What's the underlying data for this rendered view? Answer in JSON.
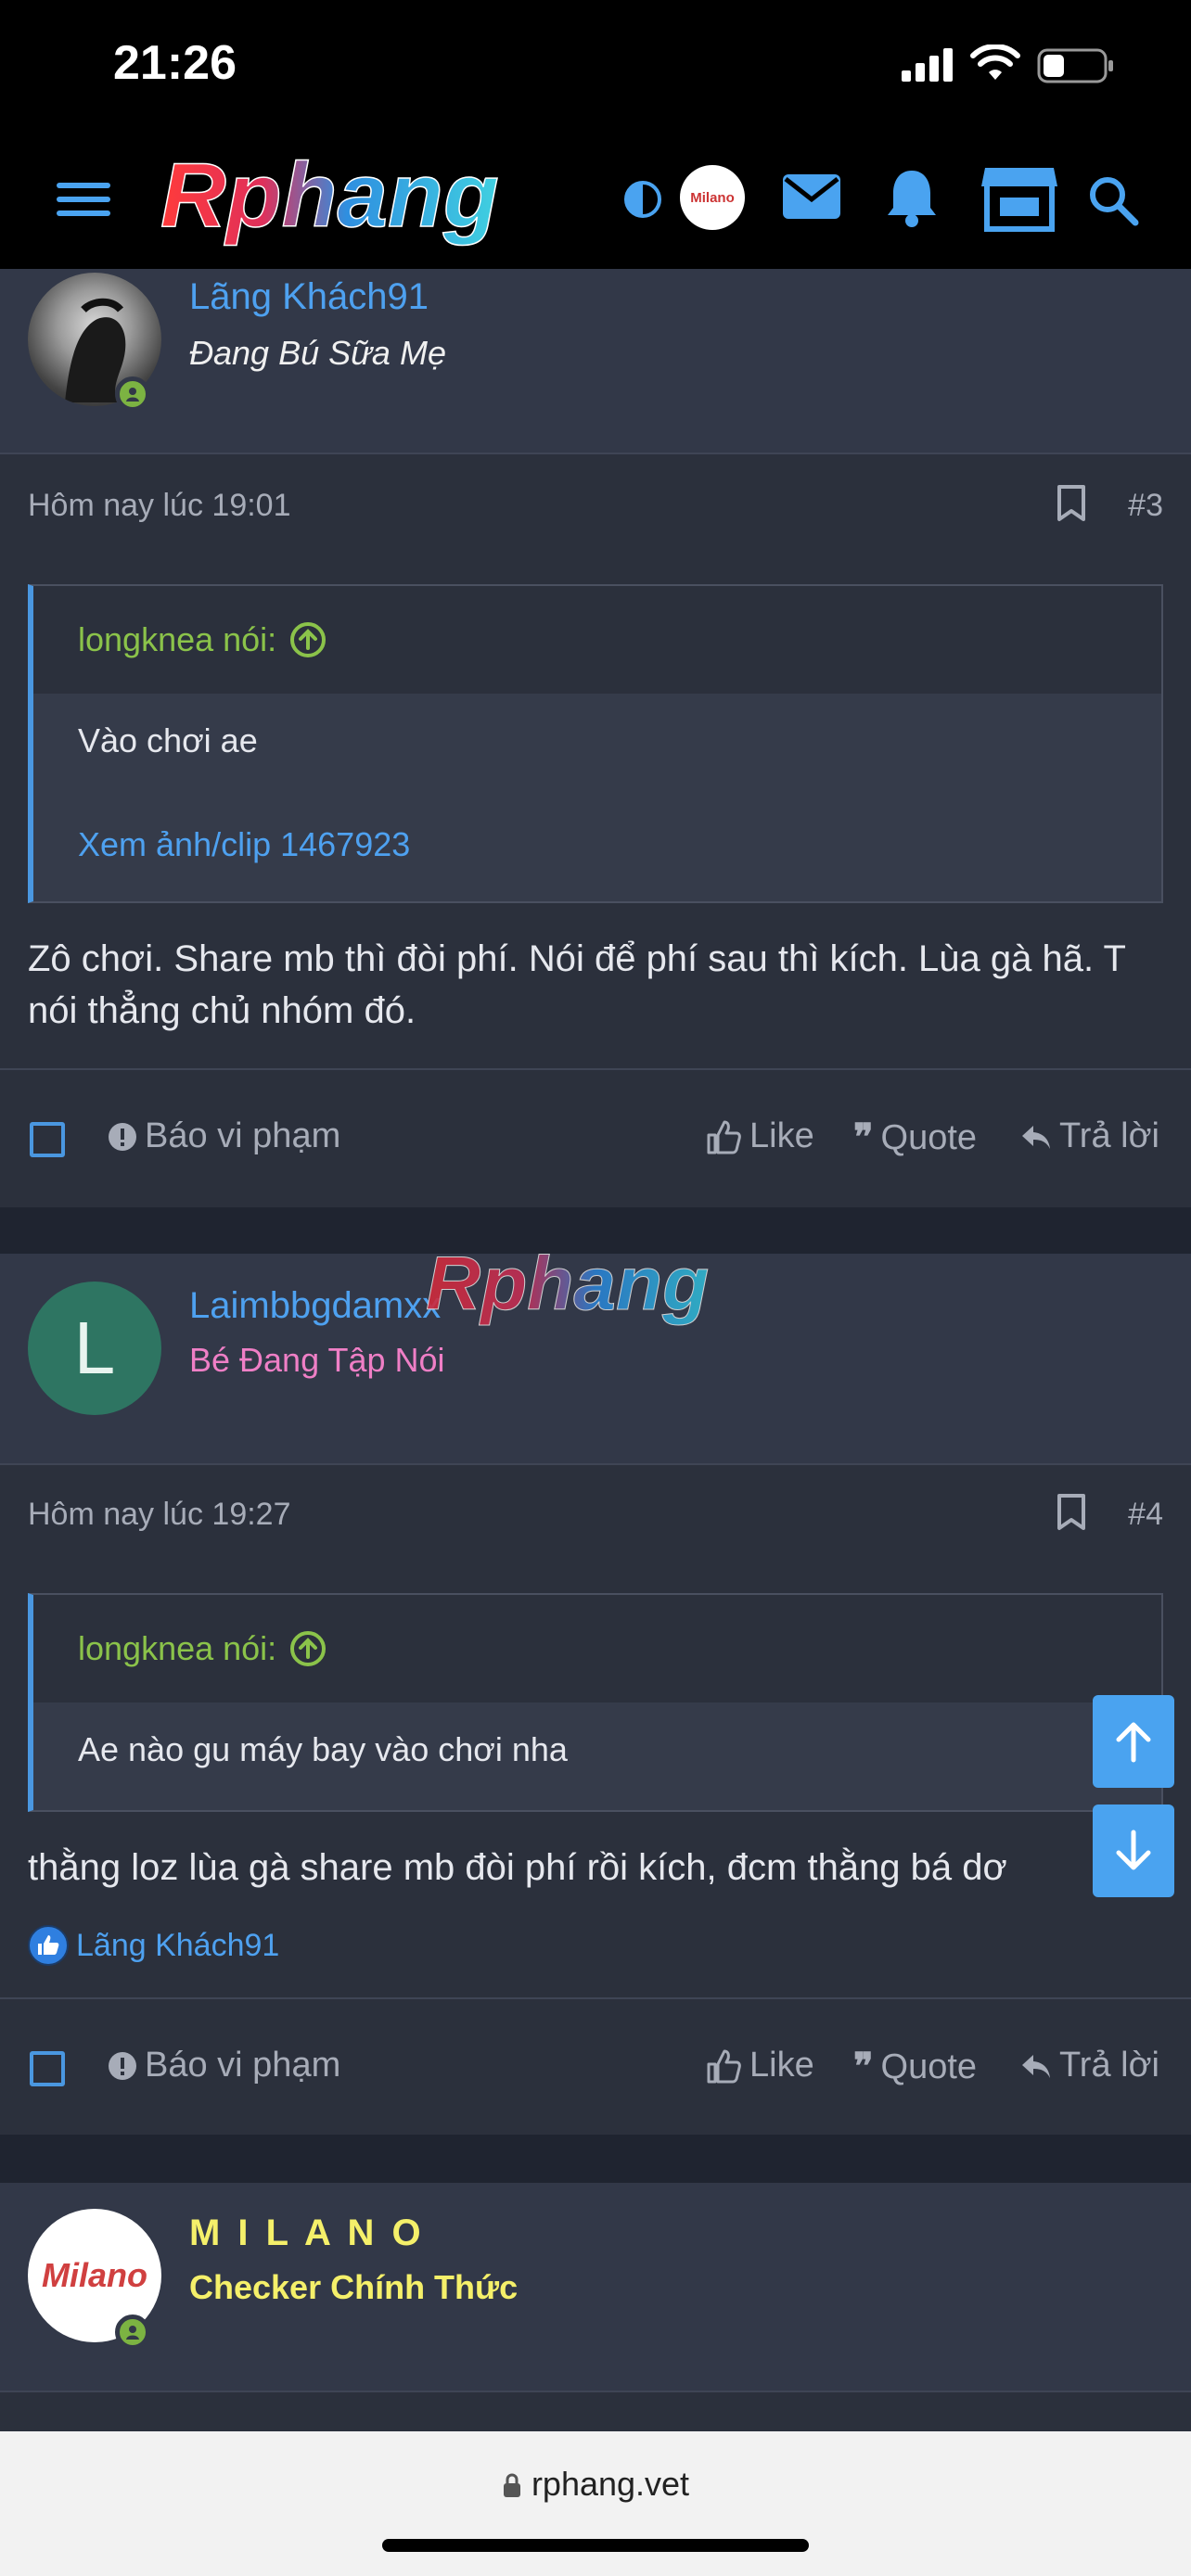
{
  "status": {
    "time": "21:26"
  },
  "header": {
    "logo": "Rphang",
    "avatar_text": "Milano"
  },
  "posts": [
    {
      "username": "Lãng Khách91",
      "usertitle": "Đang Bú Sữa Mẹ",
      "date": "Hôm nay lúc 19:01",
      "number": "#3",
      "quote_author": "longknea nói:",
      "quote_text": "Vào chơi ae",
      "quote_link": "Xem ảnh/clip 1467923",
      "text": "Zô chơi. Share mb thì đòi phí. Nói để phí sau thì kích. Lùa gà hã. T nói thẳng chủ nhóm đó."
    },
    {
      "avatar_letter": "L",
      "username": "Laimbbgdamxx",
      "usertitle": "Bé Đang Tập Nói",
      "date": "Hôm nay lúc 19:27",
      "number": "#4",
      "quote_author": "longknea nói:",
      "quote_text": "Ae nào gu máy bay vào chơi nha",
      "text": "thằng loz lùa gà share mb đòi phí rồi kích, đcm thằng bá dơ",
      "liked_by": "Lãng Khách91"
    },
    {
      "username": "M I L A N O",
      "usertitle": "Checker Chính Thức",
      "avatar_text": "Milano"
    }
  ],
  "actions": {
    "report": "Báo vi phạm",
    "like": "Like",
    "quote": "Quote",
    "reply": "Trả lời"
  },
  "watermark": "Rphang",
  "url": "rphang.vet",
  "colors": {
    "accent": "#4a97e0",
    "quote_author": "#8bc34a",
    "rank_pink": "#ef7fc6",
    "rank_yellow": "#f5f06a"
  }
}
